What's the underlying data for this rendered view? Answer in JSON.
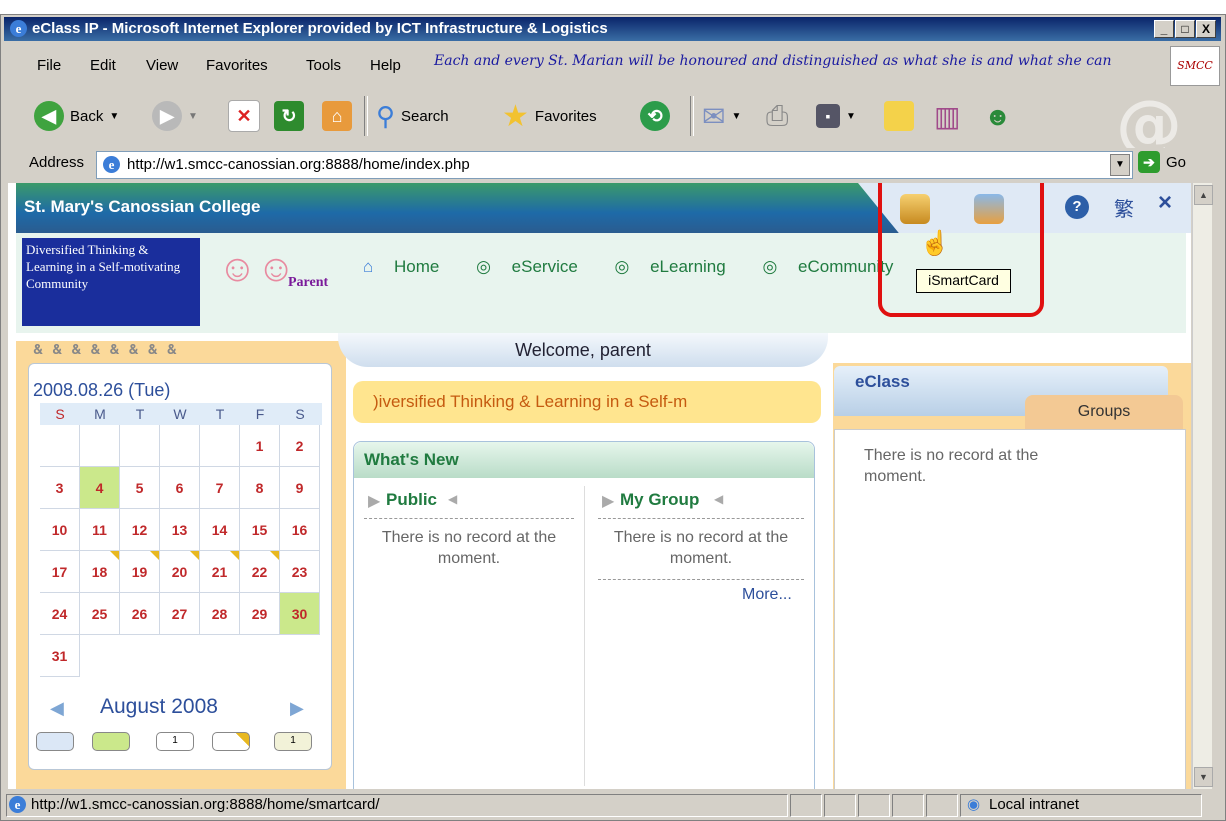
{
  "window": {
    "title": "eClass IP - Microsoft Internet Explorer provided by ICT Infrastructure & Logistics",
    "buttons": [
      "_",
      "□",
      "X"
    ]
  },
  "menubar": {
    "items": [
      "File",
      "Edit",
      "View",
      "Favorites",
      "Tools",
      "Help"
    ],
    "motto": "Each and every St. Marian will be honoured and distinguished as what she is and what she can"
  },
  "toolbar": {
    "back_label": "Back",
    "search_label": "Search",
    "favorites_label": "Favorites"
  },
  "address": {
    "label": "Address",
    "url": "http://w1.smcc-canossian.org:8888/home/index.php",
    "go_label": "Go"
  },
  "page": {
    "school_name": "St. Mary's Canossian College",
    "slogan": "Diversified Thinking & Learning in a Self-motivating Community",
    "role_label": "Parent",
    "nav": [
      "Home",
      "eService",
      "eLearning",
      "eCommunity"
    ],
    "lang_toggle": "繁",
    "close_label": "×",
    "help_label": "?",
    "tooltip": "iSmartCard",
    "welcome": "Welcome, parent",
    "marquee": ")iversified Thinking & Learning in a Self-m"
  },
  "calendar": {
    "date_label": "2008.08.26 (Tue)",
    "weekdays": [
      "S",
      "M",
      "T",
      "W",
      "T",
      "F",
      "S"
    ],
    "month_label": "August 2008"
  },
  "whats_new": {
    "title": "What's New",
    "public_title": "Public",
    "group_title": "My Group",
    "no_record": "There is no record at the moment.",
    "more": "More..."
  },
  "eclass": {
    "title": "eClass",
    "tab": "Groups",
    "no_record": "There is no record at the moment."
  },
  "status": {
    "url": "http://w1.smcc-canossian.org:8888/home/smartcard/",
    "zone": "Local intranet"
  }
}
